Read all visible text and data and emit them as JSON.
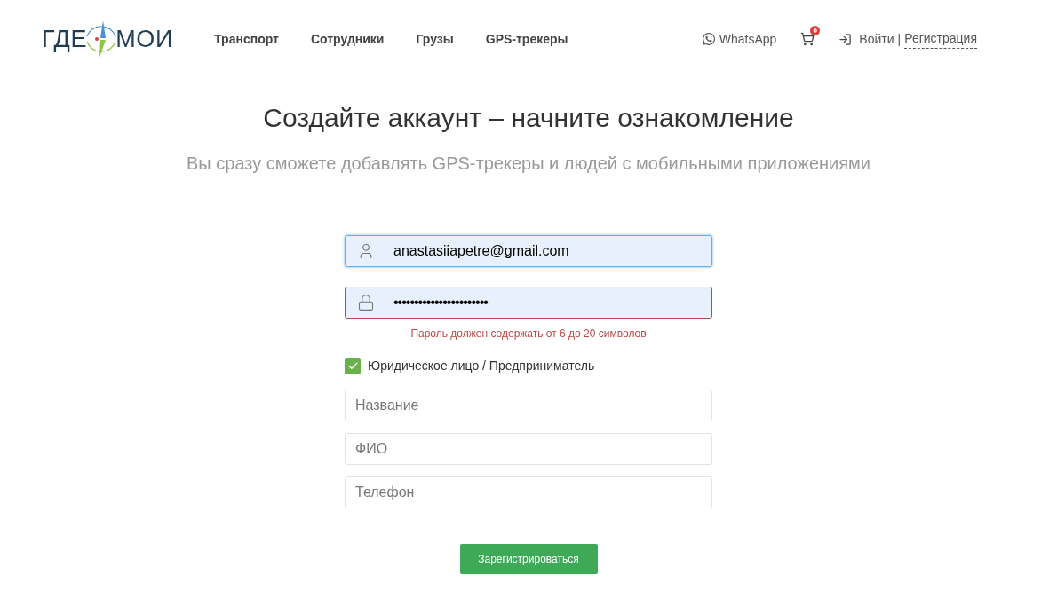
{
  "logo": {
    "left": "ГДЕ",
    "right": "МОИ"
  },
  "nav": [
    {
      "label": "Транспорт"
    },
    {
      "label": "Сотрудники"
    },
    {
      "label": "Грузы"
    },
    {
      "label": "GPS-трекеры"
    }
  ],
  "header_actions": {
    "whatsapp": "WhatsApp",
    "cart_count": "0",
    "login": "Войти",
    "separator": "|",
    "register": "Регистрация"
  },
  "title": "Создайте аккаунт – начните ознакомление",
  "subtitle": "Вы сразу сможете добавлять GPS-трекеры и людей с мобильными приложениями",
  "login_fields": [
    {
      "kind": "user",
      "value": "anastasiiapetre@gmail.com",
      "focused": true,
      "invalid": false
    },
    {
      "kind": "lock",
      "value": "•••••••••••••••••••••••",
      "focused": false,
      "invalid": true,
      "error": "Пароль должен содержать от 6 до 20 символов"
    }
  ],
  "company_checkbox": {
    "label": "Юридическое лицо / Предприниматель",
    "checked": true
  },
  "extra_fields": [
    {
      "placeholder": "Название"
    },
    {
      "placeholder": "ФИО"
    },
    {
      "placeholder": "Телефон"
    }
  ],
  "submit": "Зарегистрироваться"
}
